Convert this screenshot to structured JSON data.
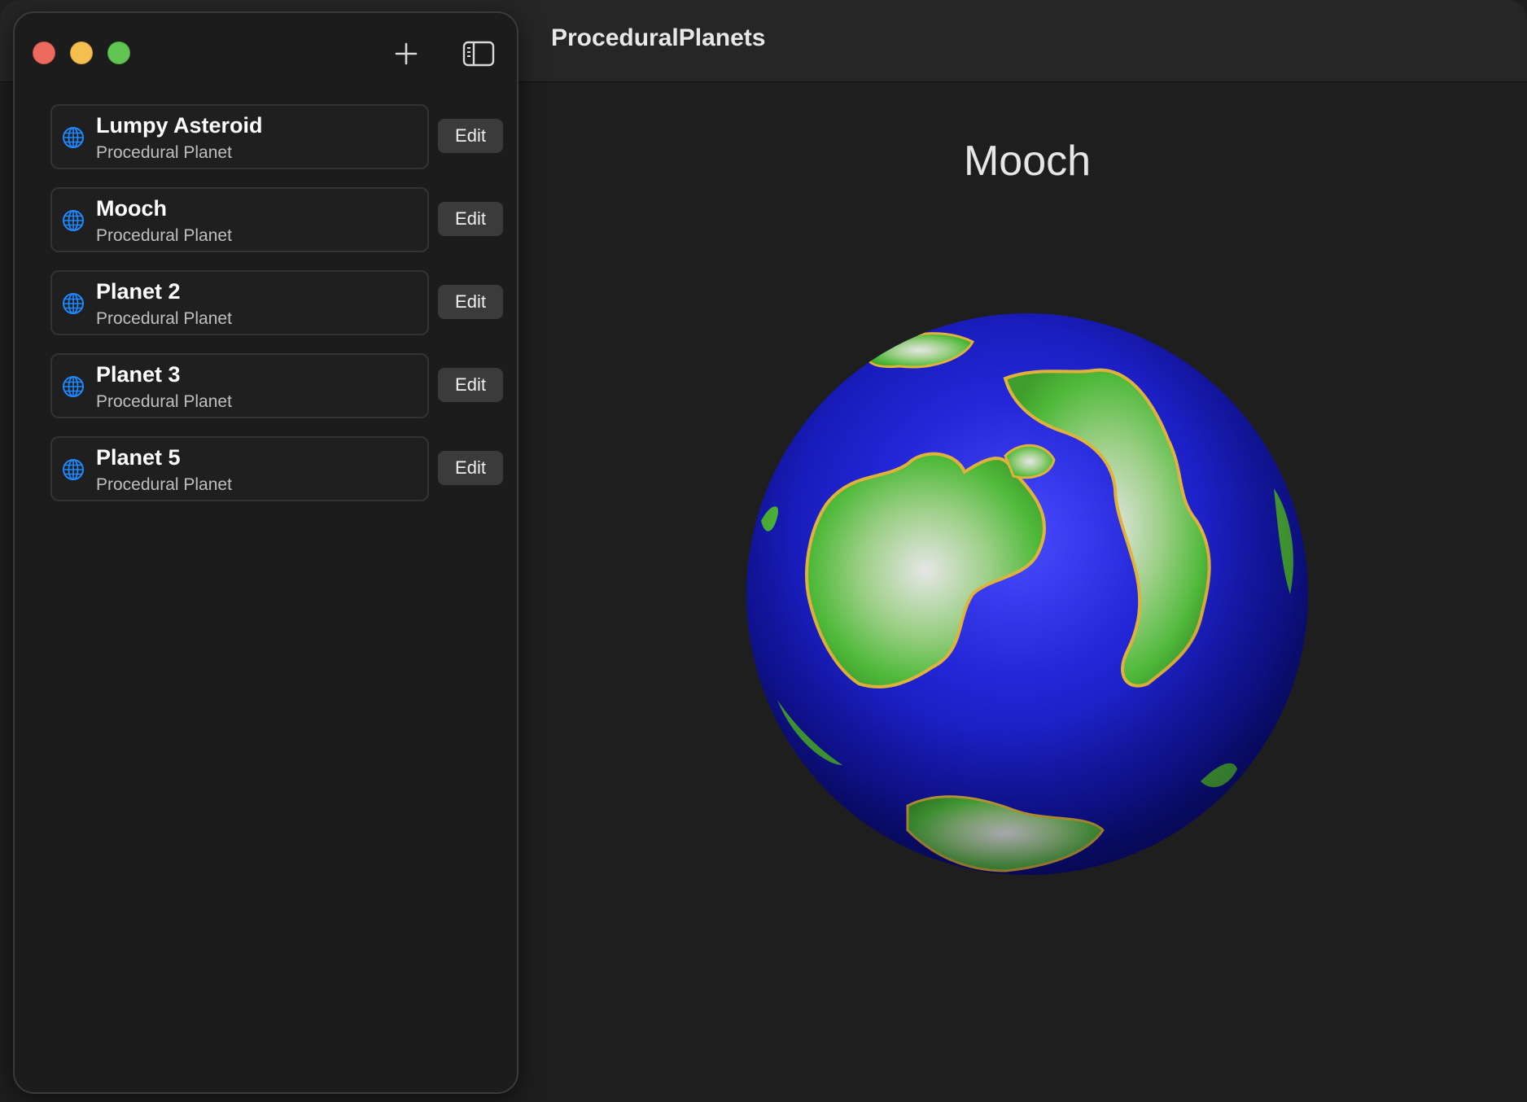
{
  "window": {
    "app_title": "ProceduralPlanets"
  },
  "toolbar": {
    "add_icon": "plus-icon",
    "sidebar_toggle_icon": "sidebar-toggle-icon"
  },
  "sidebar": {
    "items": [
      {
        "title": "Lumpy Asteroid",
        "subtitle": "Procedural Planet",
        "edit_label": "Edit",
        "icon": "globe-icon"
      },
      {
        "title": "Mooch",
        "subtitle": "Procedural Planet",
        "edit_label": "Edit",
        "icon": "globe-icon"
      },
      {
        "title": "Planet 2",
        "subtitle": "Procedural Planet",
        "edit_label": "Edit",
        "icon": "globe-icon"
      },
      {
        "title": "Planet 3",
        "subtitle": "Procedural Planet",
        "edit_label": "Edit",
        "icon": "globe-icon"
      },
      {
        "title": "Planet 5",
        "subtitle": "Procedural Planet",
        "edit_label": "Edit",
        "icon": "globe-icon"
      }
    ]
  },
  "detail": {
    "title": "Mooch"
  },
  "colors": {
    "accent": "#1e88ff",
    "ocean": "#1a1fd0",
    "land": "#5fbf3a",
    "snow": "#dcdcdc"
  }
}
